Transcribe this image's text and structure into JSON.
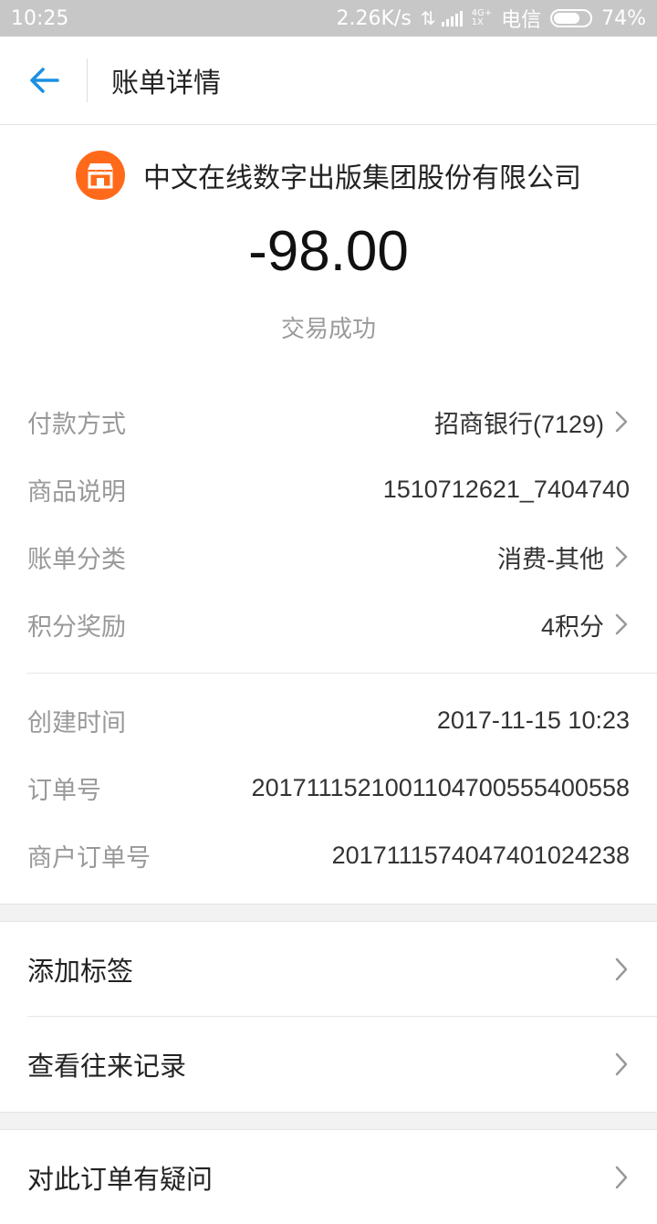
{
  "status_bar": {
    "time": "10:25",
    "net_speed": "2.26K/s",
    "net_arrows": "⇅",
    "network_type_top": "4G+",
    "network_type_bottom": "1X",
    "carrier": "电信",
    "battery": "74%",
    "battery_level": 0.74
  },
  "header": {
    "back_icon": "arrow-left-icon",
    "title": "账单详情",
    "accent_color": "#1a8fe3"
  },
  "merchant": {
    "icon": "store-icon",
    "icon_color": "#ff6a1a",
    "name": "中文在线数字出版集团股份有限公司"
  },
  "transaction": {
    "amount": "-98.00",
    "status": "交易成功"
  },
  "details": [
    {
      "label": "付款方式",
      "value": "招商银行(7129)",
      "chevron": true
    },
    {
      "label": "商品说明",
      "value": "1510712621_7404740",
      "chevron": false
    },
    {
      "label": "账单分类",
      "value": "消费-其他",
      "chevron": true
    },
    {
      "label": "积分奖励",
      "value": "4积分",
      "chevron": true
    }
  ],
  "info": [
    {
      "label": "创建时间",
      "value": "2017-11-15 10:23"
    },
    {
      "label": "订单号",
      "value": "20171115210011047005554005​58"
    },
    {
      "label": "商户订单号",
      "value": "20171115740474010242​38"
    }
  ],
  "actions": [
    {
      "label": "添加标签"
    },
    {
      "label": "查看往来记录"
    },
    {
      "label": "对此订单有疑问"
    }
  ]
}
